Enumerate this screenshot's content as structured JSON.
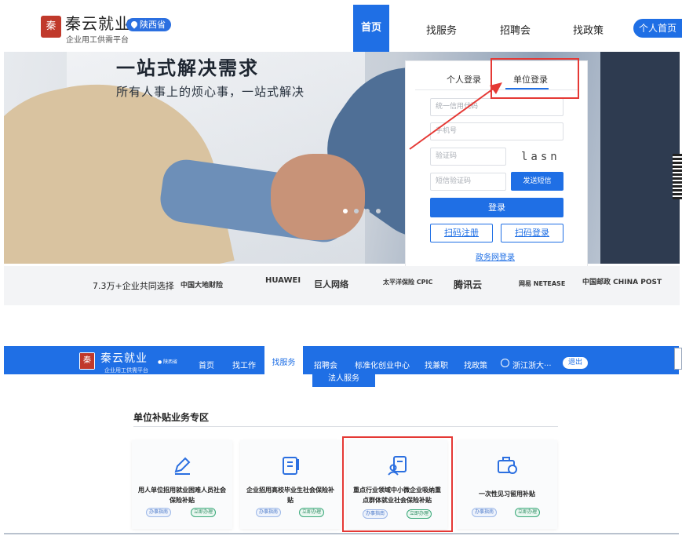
{
  "brand": {
    "seal": "秦",
    "name": "秦云就业",
    "subtitle": "企业用工供需平台",
    "region": "陕西省"
  },
  "nav": {
    "home": "首页",
    "services": "找服务",
    "job_fair": "招聘会",
    "policy": "找政策",
    "personal_home": "个人首页"
  },
  "hero": {
    "title": "一站式解决需求",
    "subtitle": "所有人事上的烦心事，一站式解决"
  },
  "login": {
    "tab_personal": "个人登录",
    "tab_company": "单位登录",
    "credit_code_placeholder": "统一信用代码",
    "phone_placeholder": "手机号",
    "captcha_placeholder": "验证码",
    "captcha_text": "lasn",
    "sms_code_placeholder": "短信验证码",
    "send_sms": "发送短信",
    "login_button": "登录",
    "scan_register": "扫码注册",
    "scan_login": "扫码登录",
    "gov_login": "政务网登录"
  },
  "partners": {
    "label": "7.3万+企业共同选择",
    "logos": [
      "中国大地财险",
      "HUAWEI",
      "巨人网络",
      "太平洋保险 CPIC",
      "腾讯云",
      "网易 NETEASE",
      "中国邮政 CHINA POST"
    ]
  },
  "nav2": {
    "seal": "秦",
    "name": "秦云就业",
    "subtitle": "企业用工供需平台",
    "region": "陕西省",
    "home": "首页",
    "find_job": "找工作",
    "services": "找服务",
    "job_fair": "招聘会",
    "startup": "标准化创业中心",
    "part_time": "找兼职",
    "policy": "找政策",
    "user": "浙江浙大···",
    "logout": "退出",
    "dropdown_item": "法人服务"
  },
  "subsidy": {
    "section_title": "单位补贴业务专区",
    "cards": [
      {
        "title": "用人单位招用就业困难人员社会保险补贴",
        "icon": "pen-edit-icon",
        "guide": "办事指南",
        "apply": "立即办理"
      },
      {
        "title": "企业招用高校毕业生社会保险补贴",
        "icon": "document-icon",
        "guide": "办事指南",
        "apply": "立即办理"
      },
      {
        "title": "重点行业领域中小微企业吸纳重点群体就业社会保险补贴",
        "icon": "person-doc-icon",
        "guide": "办事指南",
        "apply": "立即办理"
      },
      {
        "title": "一次性见习留用补贴",
        "icon": "briefcase-yen-icon",
        "guide": "办事指南",
        "apply": "立即办理"
      }
    ]
  },
  "colors": {
    "primary": "#1f6fe5",
    "annotation": "#e53935",
    "seal": "#c0392b"
  }
}
